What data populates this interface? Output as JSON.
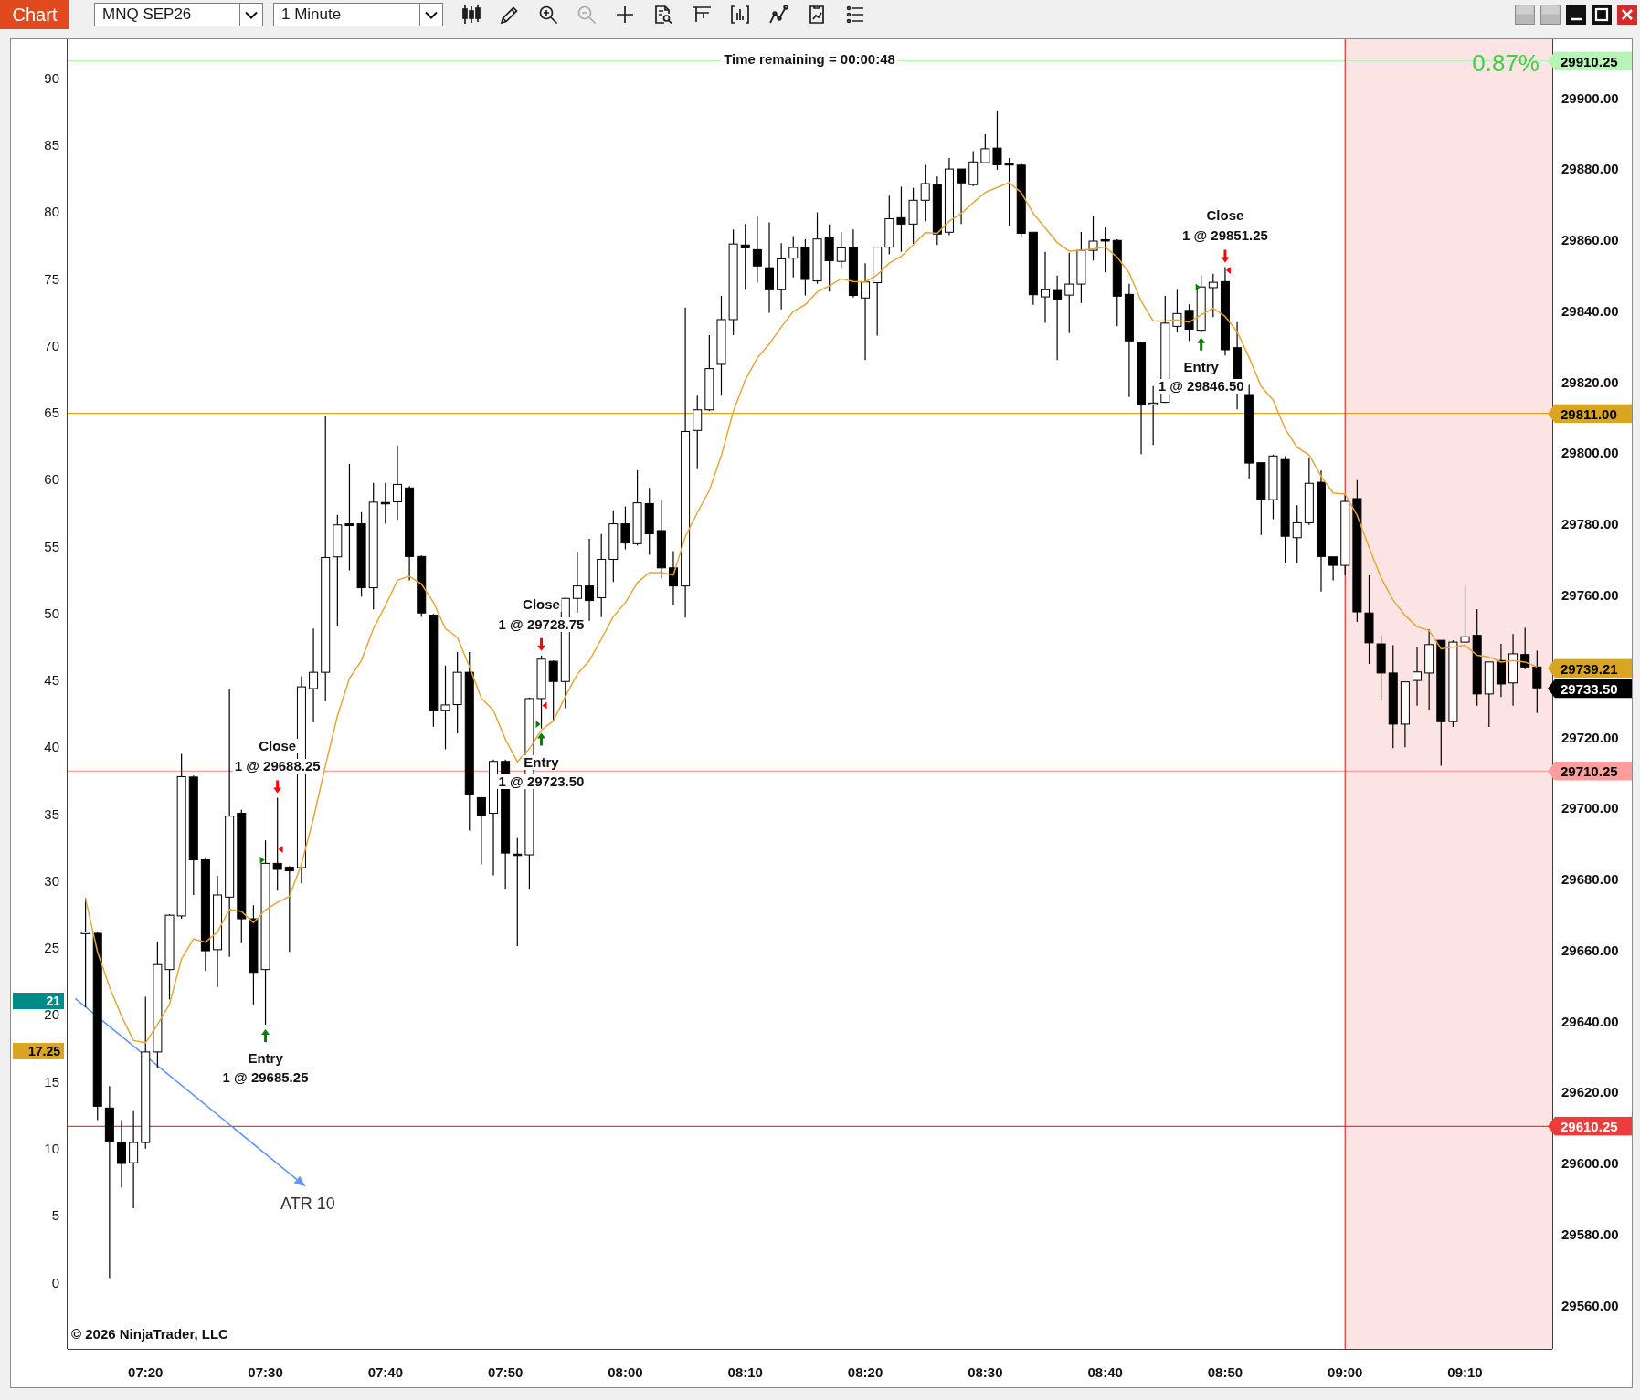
{
  "toolbar": {
    "tab": "Chart",
    "instrument": "MNQ SEP26",
    "interval": "1 Minute",
    "tools": [
      {
        "disabled": false
      },
      {
        "disabled": false
      },
      {
        "disabled": false
      },
      {
        "disabled": true
      },
      {
        "disabled": false
      },
      {
        "disabled": false
      },
      {
        "disabled": false
      },
      {
        "disabled": false
      },
      {
        "disabled": false
      },
      {
        "disabled": false
      },
      {
        "disabled": false
      }
    ]
  },
  "chart": {
    "bar_timer": "Time remaining = 00:00:48",
    "change_percent": "0.87%",
    "left_axis": {
      "ticks": [
        "90",
        "85",
        "80",
        "75",
        "70",
        "65",
        "60",
        "55",
        "50",
        "45",
        "40",
        "35",
        "30",
        "25",
        "20",
        "15",
        "10",
        "5",
        "0"
      ],
      "markers": [
        {
          "label": "21",
          "color": "#008b8b"
        },
        {
          "label": "17.25",
          "color": "#daa520"
        }
      ]
    },
    "price_axis": {
      "markers": [
        {
          "label": "29910.25",
          "color": "#b6f5b6"
        },
        {
          "label": "29811.00",
          "color": "#daa520"
        },
        {
          "label": "29739.21",
          "color": "#daa520"
        },
        {
          "label": "29733.50",
          "color": "#000000"
        },
        {
          "label": "29710.25",
          "color": "#ff9c9c"
        },
        {
          "label": "29610.25",
          "color": "#ee3b3b"
        }
      ]
    },
    "trades": [
      {
        "kind": "close",
        "title": "Close",
        "text": "1 @ 29851.25"
      },
      {
        "kind": "entry",
        "title": "Entry",
        "text": "1 @ 29846.50"
      },
      {
        "kind": "close",
        "title": "Close",
        "text": "1 @ 29728.75"
      },
      {
        "kind": "close",
        "title": "Close",
        "text": "1 @ 29688.25"
      },
      {
        "kind": "entry",
        "title": "Entry",
        "text": "1 @ 29723.50"
      },
      {
        "kind": "entry",
        "title": "Entry",
        "text": "1 @ 29685.25"
      }
    ],
    "annotation": {
      "label": "ATR 10"
    },
    "copyright": "© 2026 NinjaTrader, LLC",
    "chart_data": {
      "type": "candlestick",
      "xlim": [
        433.507,
        557.27
      ],
      "ylim": [
        29547.6,
        29916.33
      ],
      "xticks": [
        {
          "value": 440,
          "label": "07:20"
        },
        {
          "value": 450,
          "label": "07:30"
        },
        {
          "value": 460,
          "label": "07:40"
        },
        {
          "value": 470,
          "label": "07:50"
        },
        {
          "value": 480,
          "label": "08:00"
        },
        {
          "value": 490,
          "label": "08:10"
        },
        {
          "value": 500,
          "label": "08:20"
        },
        {
          "value": 510,
          "label": "08:30"
        },
        {
          "value": 520,
          "label": "08:40"
        },
        {
          "value": 530,
          "label": "08:50"
        },
        {
          "value": 540,
          "label": "09:00"
        },
        {
          "value": 550,
          "label": "09:10"
        }
      ],
      "yticks": [
        {
          "value": 29900,
          "label": "29900.00"
        },
        {
          "value": 29880,
          "label": "29880.00"
        },
        {
          "value": 29860,
          "label": "29860.00"
        },
        {
          "value": 29840,
          "label": "29840.00"
        },
        {
          "value": 29820,
          "label": "29820.00"
        },
        {
          "value": 29800,
          "label": "29800.00"
        },
        {
          "value": 29780,
          "label": "29780.00"
        },
        {
          "value": 29760,
          "label": "29760.00"
        },
        {
          "value": 29720,
          "label": "29720.00"
        },
        {
          "value": 29700,
          "label": "29700.00"
        },
        {
          "value": 29680,
          "label": "29680.00"
        },
        {
          "value": 29660,
          "label": "29660.00"
        },
        {
          "value": 29640,
          "label": "29640.00"
        },
        {
          "value": 29620,
          "label": "29620.00"
        },
        {
          "value": 29600,
          "label": "29600.00"
        },
        {
          "value": 29580,
          "label": "29580.00"
        },
        {
          "value": 29560,
          "label": "29560.00"
        }
      ],
      "ref_lines": [
        {
          "axis": "y",
          "value": 29910.25,
          "color": "#b6f5b6"
        },
        {
          "axis": "y",
          "value": 29811,
          "color": "#daa520"
        },
        {
          "axis": "y",
          "value": 29710.25,
          "color": "#ff9c9c"
        },
        {
          "axis": "y",
          "value": 29610.25,
          "color": "#ee3b3b"
        },
        {
          "axis": "x",
          "value": 540,
          "color": "#e03030"
        }
      ],
      "bands": [
        {
          "axis": "x",
          "from": 540,
          "to": 557.27,
          "color": "#fde4e4"
        }
      ],
      "x": [
        435,
        436,
        437,
        438,
        439,
        440,
        441,
        442,
        443,
        444,
        445,
        446,
        447,
        448,
        449,
        450,
        451,
        452,
        453,
        454,
        455,
        456,
        457,
        458,
        459,
        460,
        461,
        462,
        463,
        464,
        465,
        466,
        467,
        468,
        469,
        470,
        471,
        472,
        473,
        474,
        475,
        476,
        477,
        478,
        479,
        480,
        481,
        482,
        483,
        484,
        485,
        486,
        487,
        488,
        489,
        490,
        491,
        492,
        493,
        494,
        495,
        496,
        497,
        498,
        499,
        500,
        501,
        502,
        503,
        504,
        505,
        506,
        507,
        508,
        509,
        510,
        511,
        512,
        513,
        514,
        515,
        516,
        517,
        518,
        519,
        520,
        521,
        522,
        523,
        524,
        525,
        526,
        527,
        528,
        529,
        530,
        531,
        532,
        533,
        534,
        535,
        536,
        537,
        538,
        539,
        540,
        541,
        542,
        543,
        544,
        545,
        546,
        547,
        548,
        549,
        550,
        551,
        552,
        553,
        554,
        555,
        556
      ],
      "ohlc": [
        [
          29664.5,
          29674.5,
          29643.8,
          29665
        ],
        [
          29664.6,
          29665,
          29612,
          29615.9
        ],
        [
          29615.4,
          29621.6,
          29567.5,
          29606
        ],
        [
          29605.7,
          29612,
          29593,
          29599.8
        ],
        [
          29600,
          29614.8,
          29587.2,
          29605.7
        ],
        [
          29605.7,
          29646.7,
          29604,
          29631.2
        ],
        [
          29631.2,
          29662.1,
          29626.6,
          29655.8
        ],
        [
          29654.4,
          29670,
          29646,
          29669.7
        ],
        [
          29669.5,
          29715.1,
          29668.7,
          29708.7
        ],
        [
          29708.6,
          29709,
          29675.4,
          29685.3
        ],
        [
          29685.3,
          29686,
          29654,
          29659.7
        ],
        [
          29660,
          29680.7,
          29649.5,
          29675.4
        ],
        [
          29674.8,
          29733.5,
          29658,
          29697.6
        ],
        [
          29698.4,
          29699.4,
          29661.8,
          29668.7
        ],
        [
          29668.7,
          29672.5,
          29644.6,
          29653.6
        ],
        [
          29654.4,
          29690.8,
          29638.9,
          29684.3
        ],
        [
          29684.3,
          29702.8,
          29676.6,
          29682.6
        ],
        [
          29683.2,
          29683.5,
          29659.4,
          29682.2
        ],
        [
          29683.1,
          29737,
          29678.7,
          29734
        ],
        [
          29733.5,
          29750.4,
          29724,
          29738.1
        ],
        [
          29738.1,
          29810.2,
          29729.9,
          29770.4
        ],
        [
          29770.6,
          29782.4,
          29751.2,
          29779.6
        ],
        [
          29779.9,
          29796.8,
          29766.8,
          29779.4
        ],
        [
          29779.9,
          29783.2,
          29759.4,
          29761.9
        ],
        [
          29761.9,
          29791.4,
          29755.8,
          29786
        ],
        [
          29785.9,
          29791.4,
          29779.9,
          29785.6
        ],
        [
          29786.1,
          29802,
          29781,
          29791
        ],
        [
          29790,
          29790.5,
          29764,
          29770.7
        ],
        [
          29770.7,
          29771,
          29753.7,
          29754.8
        ],
        [
          29754.2,
          29754.5,
          29722.8,
          29727.4
        ],
        [
          29727.4,
          29740,
          29716.4,
          29728.9
        ],
        [
          29729,
          29743.8,
          29720.9,
          29738.1
        ],
        [
          29738.1,
          29743.8,
          29693.5,
          29703.6
        ],
        [
          29702.8,
          29703,
          29684,
          29697.9
        ],
        [
          29698.4,
          29713.5,
          29680.9,
          29713
        ],
        [
          29713,
          29713.5,
          29677.2,
          29687.2
        ],
        [
          29686.9,
          29691.4,
          29661,
          29686.8
        ],
        [
          29686.7,
          29731,
          29677.2,
          29730.7
        ],
        [
          29730.7,
          29742.8,
          29722.3,
          29741.8
        ],
        [
          29741.2,
          29741.5,
          29724.5,
          29735.5
        ],
        [
          29735.5,
          29759,
          29728,
          29758.9
        ],
        [
          29758.9,
          29772,
          29754.9,
          29762.4
        ],
        [
          29762.4,
          29775.7,
          29752.6,
          29758.3
        ],
        [
          29759.1,
          29777,
          29753.6,
          29769.9
        ],
        [
          29769.9,
          29783.7,
          29763.5,
          29779.9
        ],
        [
          29779.9,
          29784.8,
          29772.7,
          29774.5
        ],
        [
          29774.3,
          29795,
          29773.8,
          29785.8
        ],
        [
          29785.6,
          29790,
          29771.2,
          29777.1
        ],
        [
          29778,
          29786.6,
          29764.5,
          29767.5
        ],
        [
          29767.5,
          29772.2,
          29757,
          29762.4
        ],
        [
          29762.4,
          29840.8,
          29753.5,
          29805.9
        ],
        [
          29806.2,
          29816,
          29795.3,
          29812
        ],
        [
          29812,
          29833,
          29811.7,
          29823.6
        ],
        [
          29824.8,
          29844.1,
          29816,
          29837.4
        ],
        [
          29837.4,
          29862.8,
          29833,
          29858.7
        ],
        [
          29858.4,
          29864.3,
          29845.8,
          29857.6
        ],
        [
          29857.1,
          29866.4,
          29847.8,
          29852.5
        ],
        [
          29852,
          29864.8,
          29839.3,
          29845.8
        ],
        [
          29845.8,
          29858.9,
          29840.3,
          29854.5
        ],
        [
          29854.7,
          29860.9,
          29849.3,
          29857.7
        ],
        [
          29857.6,
          29860,
          29844.2,
          29848.7
        ],
        [
          29848.3,
          29867.6,
          29847.5,
          29860.1
        ],
        [
          29860.4,
          29864.2,
          29845.3,
          29854
        ],
        [
          29853.8,
          29862,
          29852,
          29857.6
        ],
        [
          29857.8,
          29862.8,
          29843.6,
          29844.2
        ],
        [
          29843.5,
          29853.3,
          29826,
          29848
        ],
        [
          29847.8,
          29857.8,
          29832.9,
          29857.8
        ],
        [
          29857.8,
          29872.3,
          29855.8,
          29865.8
        ],
        [
          29866.1,
          29874.8,
          29856.5,
          29864.3
        ],
        [
          29864.3,
          29874.5,
          29858.7,
          29871
        ],
        [
          29871,
          29881,
          29865.1,
          29875.7
        ],
        [
          29875.4,
          29877.7,
          29858.4,
          29861.5
        ],
        [
          29862,
          29882.9,
          29861.2,
          29879.8
        ],
        [
          29879.8,
          29879.8,
          29864.3,
          29875.9
        ],
        [
          29875.4,
          29884.8,
          29875,
          29881.8
        ],
        [
          29881.6,
          29889.6,
          29881.6,
          29885.5
        ],
        [
          29885.7,
          29896.3,
          29879.6,
          29881
        ],
        [
          29881.3,
          29882.9,
          29863.6,
          29881.2
        ],
        [
          29880.9,
          29881.6,
          29860.6,
          29861.7
        ],
        [
          29862,
          29862.1,
          29841.6,
          29844.4
        ],
        [
          29843.8,
          29856.5,
          29836.5,
          29845.8
        ],
        [
          29845.6,
          29849.8,
          29826,
          29843.2
        ],
        [
          29844.3,
          29856.2,
          29833.6,
          29847.4
        ],
        [
          29847.4,
          29862.1,
          29842.1,
          29856.9
        ],
        [
          29856.9,
          29866.6,
          29854,
          29859.5
        ],
        [
          29859.9,
          29863.3,
          29850.7,
          29859.8
        ],
        [
          29859.7,
          29860,
          29835.5,
          29844
        ],
        [
          29844.5,
          29847.5,
          29815.6,
          29831.4
        ],
        [
          29830.9,
          29830.9,
          29799.5,
          29813.4
        ],
        [
          29813.4,
          29818.7,
          29802.1,
          29813.9
        ],
        [
          29814.1,
          29844.1,
          29813.9,
          29836.4
        ],
        [
          29835.5,
          29845.8,
          29834,
          29839.1
        ],
        [
          29840,
          29841.7,
          29831.4,
          29834.7
        ],
        [
          29834.4,
          29849.9,
          29833.6,
          29846.6
        ],
        [
          29846.4,
          29850.3,
          29838.1,
          29847.9
        ],
        [
          29848.1,
          29852.2,
          29827.3,
          29828.9
        ],
        [
          29829.5,
          29836.7,
          29812.1,
          29816.7
        ],
        [
          29816.3,
          29819,
          29792.4,
          29797
        ],
        [
          29797.1,
          29797.1,
          29776.8,
          29786.7
        ],
        [
          29786.7,
          29799.4,
          29781.2,
          29799
        ],
        [
          29798,
          29798.9,
          29768.8,
          29776.4
        ],
        [
          29776,
          29785.1,
          29768.8,
          29780.2
        ],
        [
          29780.2,
          29798.6,
          29779.6,
          29791.3
        ],
        [
          29791.6,
          29794.9,
          29760.8,
          29770.7
        ],
        [
          29770.6,
          29770.6,
          29764,
          29768.2
        ],
        [
          29768.2,
          29788.4,
          29765.4,
          29786.2
        ],
        [
          29787,
          29792.2,
          29752.3,
          29755.1
        ],
        [
          29754.8,
          29765.4,
          29740.4,
          29746.4
        ],
        [
          29746.1,
          29748.5,
          29730.2,
          29737.9
        ],
        [
          29737.9,
          29745.7,
          29716.7,
          29723.5
        ],
        [
          29723.5,
          29735.4,
          29717,
          29735.4
        ],
        [
          29735.8,
          29745.2,
          29728.7,
          29738.2
        ],
        [
          29737.9,
          29750.2,
          29727.6,
          29745.9
        ],
        [
          29747.1,
          29747.1,
          29711.8,
          29724.2
        ],
        [
          29724.2,
          29747.1,
          29722.7,
          29746.6
        ],
        [
          29746.6,
          29762.6,
          29746.4,
          29748.1
        ],
        [
          29748.5,
          29755.9,
          29728.7,
          29732
        ],
        [
          29732,
          29741,
          29722.7,
          29741
        ],
        [
          29741.4,
          29746.1,
          29731.1,
          29734.8
        ],
        [
          29735.1,
          29748.9,
          29728.7,
          29743.3
        ],
        [
          29743.1,
          29750.6,
          29739,
          29739.6
        ],
        [
          29739.6,
          29744.2,
          29726.6,
          29733.7
        ]
      ],
      "series": [
        {
          "type": "line",
          "color": "#e3a83a",
          "values": [
            29674.4,
            29659.4,
            29649.5,
            29641.3,
            29634.4,
            29633.8,
            29638.9,
            29644.6,
            29657.4,
            29663,
            29662.1,
            29665,
            29671.3,
            29670.8,
            29667.6,
            29671.2,
            29673.3,
            29675,
            29684,
            29697,
            29711.8,
            29725.8,
            29736.4,
            29741.4,
            29750.4,
            29756.9,
            29764,
            29765.1,
            29763,
            29757.8,
            29750.4,
            29747.9,
            29739.7,
            29730.7,
            29727.4,
            29719.2,
            29712.9,
            29716.6,
            29721.8,
            29724.4,
            29731.3,
            29737.6,
            29741.4,
            29747.5,
            29753.8,
            29757.7,
            29763.3,
            29766.2,
            29766.2,
            29765.5,
            29776.3,
            29783,
            29789.3,
            29799.1,
            29811.5,
            29820.4,
            29826.6,
            29830.5,
            29835.3,
            29839.7,
            29841.6,
            29845.2,
            29846.9,
            29848.9,
            29848.1,
            29848,
            29850,
            29853.3,
            29855.2,
            29858.4,
            29861.9,
            29861.7,
            29865.1,
            29867.3,
            29870.3,
            29873.2,
            29874.6,
            29876,
            29873.2,
            29867.3,
            29863.2,
            29859.1,
            29856.7,
            29856.9,
            29857.3,
            29857.8,
            29855,
            29850.5,
            29842.6,
            29837,
            29837,
            29837.3,
            29836.7,
            29838.7,
            29840.6,
            29838.3,
            29834,
            29826.7,
            29818.6,
            29814.7,
            29806.6,
            29801.4,
            29799.3,
            29793.3,
            29788.6,
            29788.3,
            29782.3,
            29773.2,
            29764.7,
            29758.4,
            29754.1,
            29750.9,
            29749.9,
            29744.7,
            29745.2,
            29745.7,
            29742.9,
            29742.4,
            29741,
            29741.4,
            29741,
            29739.6
          ]
        }
      ]
    }
  }
}
